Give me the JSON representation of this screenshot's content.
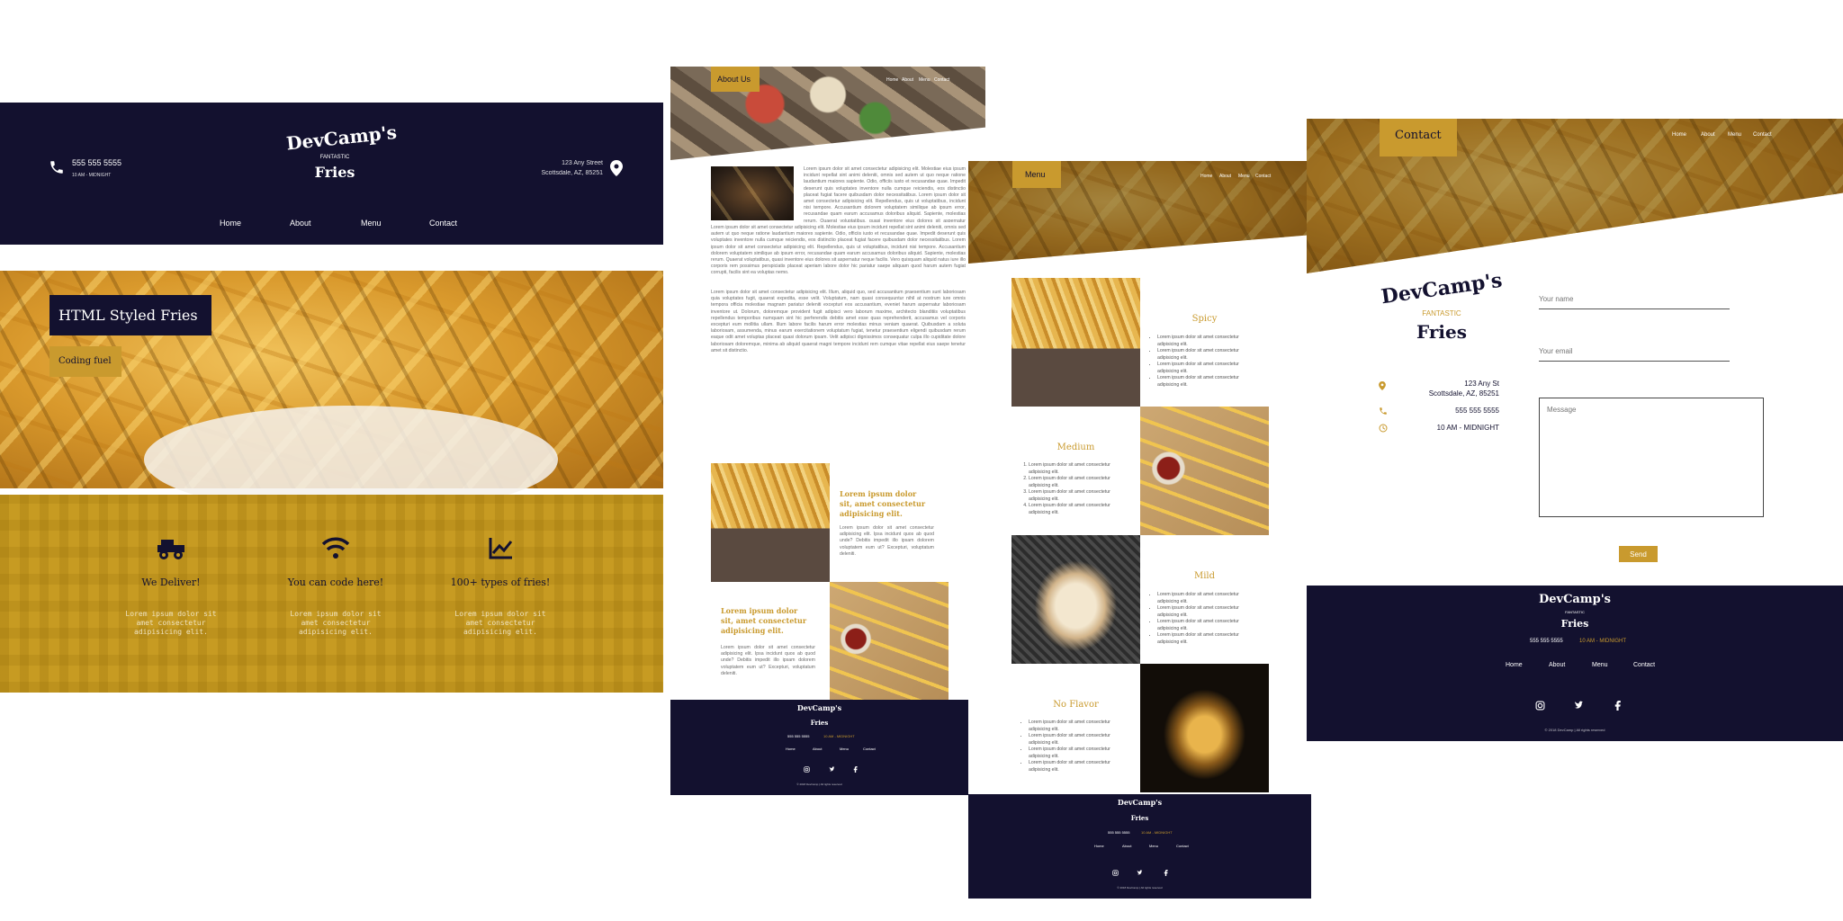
{
  "colors": {
    "navy": "#13112f",
    "gold": "#c99a2e",
    "white": "#ffffff"
  },
  "home": {
    "phone": "555 555 5555",
    "hours": "10 AM - MIDNIGHT",
    "logo_top": "DevCamp's",
    "logo_mid": "FANTASTIC",
    "logo_bottom": "Fries",
    "address_line1": "123 Any Street",
    "address_line2": "Scottsdale, AZ, 85251",
    "nav": [
      "Home",
      "About",
      "Menu",
      "Contact"
    ],
    "hero_title": "HTML Styled Fries",
    "hero_sub": "Coding fuel",
    "features": [
      {
        "icon": "truck-icon",
        "title": "We Deliver!",
        "text": "Lorem ipsum dolor sit amet consectetur adipisicing elit."
      },
      {
        "icon": "wifi-icon",
        "title": "You can code here!",
        "text": "Lorem ipsum dolor sit amet consectetur adipisicing elit."
      },
      {
        "icon": "chart-icon",
        "title": "100+ types of fries!",
        "text": "Lorem ipsum dolor sit amet consectetur adipisicing elit."
      }
    ]
  },
  "about": {
    "badge": "About Us",
    "nav": [
      "Home",
      "About",
      "Menu",
      "Contact"
    ],
    "para1": "Lorem ipsum dolor sit amet consectetur adipisicing elit. Molestiae eius ipsum incidunt repellat sint animi deleniti, omnis sed autem ut quo neque ratione laudantium maiores sapiente. Odio, officiis iusto et recusandae quae. Impedit deserunt quis voluptates inventore nulla cumque reiciendis, eos distinctio placeat fugiat facere quibusdam dolor necessitatibus. Lorem ipsum dolor sit amet consectetur adipisicing elit. Repellendus, quis ut voluptatibus, incidunt nisi tempore. Accusantium dolorem voluptatem similique ab ipsum error, recusandae quam earum accusamus doloribus aliquid. Sapiente, molestias rerum. Quaerat voluptatibus, quasi inventore eius dolores sit aspernatur neque facilis. Vero quisquam aliquid natus iure illo corporis rem possimus perspiciatis placeat aperiam labore dolor hic pariatur saepe aliquam quod harum autem fugiat corrupti, facilis sint ea voluptas nemo.",
    "para2": "Lorem ipsum dolor sit amet consectetur adipisicing elit. Illum, aliquid quo, sed accusantium praesentium sunt laboriosam quia voluptates fugit, quaerat expedita, esse velit. Voluptatum, nam quasi consequuntur nihil at nostrum iure omnis tempora officia molestiae magnam pariatur deleniti excepturi eos accusantium, eveniet harum aspernatur laboriosam inventore ut. Dolorum, doloremque provident fugit adipisci vero laborum maxime, architecto blanditiis voluptatibus repellendus temporibus numquam sint hic perferendis debitis amet esse quas reprehenderit, accusamus vel corporis excepturi eum mollitia ullam. Illum labore facilis harum error molestias minus veniam quaerat. Quibusdam a soluta laboriosam, assumenda, minus earum exercitationem voluptatum fugiat, tenetur praesentium eligendi quibusdam rerum eaque odit amet voluptas placeat quasi dolorum ipsam. Velit adipisci dignissimos consequatur culpa illo cupiditate dolore laboriosam doloremque, minima ab aliquid quaerat magni tempore incidunt rem cumque vitae repellat eius saepe tenetur amet sit distinctio.",
    "card1_title": "Lorem ipsum dolor sit, amet consectetur adipisicing elit.",
    "card1_text": "Lorem ipsum dolor sit amet consectetur adipisicing elit. Ipsa incidunt quos ab quod unde? Debitis impedit illo ipsam dolorem voluptatem eum ut? Excepturi, voluptatum deleniti.",
    "card2_title": "Lorem ipsum dolor sit, amet consectetur adipisicing elit.",
    "card2_text": "Lorem ipsum dolor sit amet consectetur adipisicing elit. Ipsa incidunt quos ab quod unde? Debitis impedit illo ipsam dolorem voluptatem eum ut? Excepturi, voluptatum deleniti."
  },
  "menu": {
    "badge": "Menu",
    "nav": [
      "Home",
      "About",
      "Menu",
      "Contact"
    ],
    "items": [
      {
        "name": "Spicy",
        "lines": [
          "Lorem ipsum dolor sit amet consectetur adipisicing elit.",
          "Lorem ipsum dolor sit amet consectetur adipisicing elit.",
          "Lorem ipsum dolor sit amet consectetur adipisicing elit.",
          "Lorem ipsum dolor sit amet consectetur adipisicing elit."
        ]
      },
      {
        "name": "Medium",
        "lines": [
          "Lorem ipsum dolor sit amet consectetur adipisicing elit.",
          "Lorem ipsum dolor sit amet consectetur adipisicing elit.",
          "Lorem ipsum dolor sit amet consectetur adipisicing elit.",
          "Lorem ipsum dolor sit amet consectetur adipisicing elit."
        ]
      },
      {
        "name": "Mild",
        "lines": [
          "Lorem ipsum dolor sit amet consectetur adipisicing elit.",
          "Lorem ipsum dolor sit amet consectetur adipisicing elit.",
          "Lorem ipsum dolor sit amet consectetur adipisicing elit.",
          "Lorem ipsum dolor sit amet consectetur adipisicing elit."
        ]
      },
      {
        "name": "No Flavor",
        "lines": [
          "Lorem ipsum dolor sit amet consectetur adipisicing elit.",
          "Lorem ipsum dolor sit amet consectetur adipisicing elit.",
          "Lorem ipsum dolor sit amet consectetur adipisicing elit.",
          "Lorem ipsum dolor sit amet consectetur adipisicing elit."
        ]
      }
    ]
  },
  "contact": {
    "badge": "Contact",
    "nav": [
      "Home",
      "About",
      "Menu",
      "Contact"
    ],
    "address1": "123 Any St",
    "address2": "Scottsdale, AZ, 85251",
    "phone": "555 555 5555",
    "hours": "10 AM - MIDNIGHT",
    "name_placeholder": "Your name",
    "email_placeholder": "Your email",
    "message_placeholder": "Message",
    "send": "Send"
  },
  "footer": {
    "phone": "555 555 5555",
    "hours": "10 AM - MIDNIGHT",
    "nav": [
      "Home",
      "About",
      "Menu",
      "Contact"
    ],
    "copyright": "© 2018 DevCamp | All rights reserved"
  }
}
